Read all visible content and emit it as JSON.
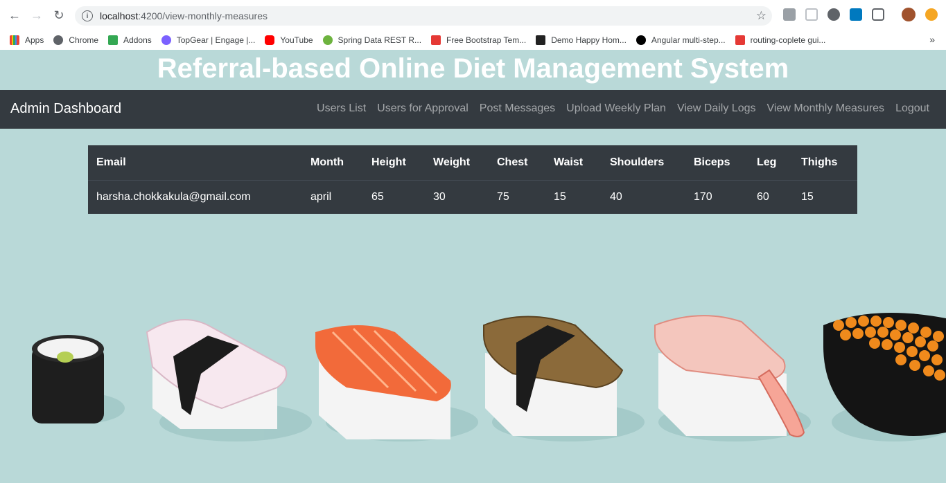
{
  "browser": {
    "url_host": "localhost",
    "url_rest": ":4200/view-monthly-measures",
    "bookmarks": [
      {
        "label": "Apps",
        "color": "#ea4335"
      },
      {
        "label": "Chrome",
        "color": "#5f6368"
      },
      {
        "label": "Addons",
        "color": "#34a853"
      },
      {
        "label": "TopGear | Engage |...",
        "color": "#7b61ff"
      },
      {
        "label": "YouTube",
        "color": "#ff0000"
      },
      {
        "label": "Spring Data REST R...",
        "color": "#6db33f"
      },
      {
        "label": "Free Bootstrap Tem...",
        "color": "#e53935"
      },
      {
        "label": "Demo Happy Hom...",
        "color": "#222222"
      },
      {
        "label": "Angular multi-step...",
        "color": "#000000"
      },
      {
        "label": "routing-coplete gui...",
        "color": "#e53935"
      }
    ],
    "more": "»"
  },
  "page": {
    "title": "Referral-based Online Diet Management System"
  },
  "navbar": {
    "brand": "Admin Dashboard",
    "links": [
      "Users List",
      "Users for Approval",
      "Post Messages",
      "Upload Weekly Plan",
      "View Daily Logs",
      "View Monthly Measures",
      "Logout"
    ]
  },
  "table": {
    "headers": [
      "Email",
      "Month",
      "Height",
      "Weight",
      "Chest",
      "Waist",
      "Shoulders",
      "Biceps",
      "Leg",
      "Thighs"
    ],
    "rows": [
      [
        "harsha.chokkakula@gmail.com",
        "april",
        "65",
        "30",
        "75",
        "15",
        "40",
        "170",
        "60",
        "15"
      ]
    ]
  },
  "colors": {
    "background": "#b9d9d8",
    "navbar": "#343a40",
    "table": "#343a40"
  }
}
